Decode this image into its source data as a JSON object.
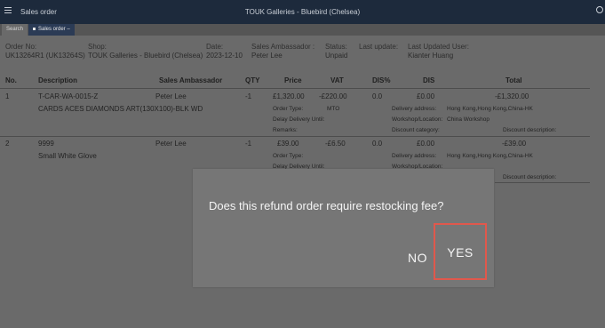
{
  "topbar": {
    "app_title": "Sales order",
    "window_title": "TOUK Galleries - Bluebird (Chelsea)"
  },
  "tabs": {
    "search": "Search",
    "active": "Sales order",
    "active_suffix": "–"
  },
  "header": {
    "order_no_label": "Order No:",
    "order_no_value": "UK13264R1 (UK13264S)",
    "shop_label": "Shop:",
    "shop_value": "TOUK Galleries - Bluebird (Chelsea)",
    "date_label": "Date:",
    "date_value": "2023-12-10",
    "ambassador_label": "Sales Ambassador :",
    "ambassador_value": "Peter Lee",
    "status_label": "Status:",
    "status_value": "Unpaid",
    "last_update_label": "Last update:",
    "last_user_label": "Last Updated User:",
    "last_user_value": "Kianter Huang"
  },
  "table": {
    "columns": [
      "No.",
      "Description",
      "Sales Ambassador",
      "QTY",
      "Price",
      "VAT",
      "DIS%",
      "DIS",
      "Total"
    ],
    "rows": [
      {
        "no": "1",
        "code": "T-CAR-WA-0015-Z",
        "ambassador": "Peter Lee",
        "qty": "-1",
        "price": "£1,320.00",
        "vat": "-£220.00",
        "dis_pct": "0.0",
        "dis": "£0.00",
        "total": "-£1,320.00",
        "desc": "CARDS ACES DIAMONDS ART(130X100)-BLK WD",
        "order_type_label": "Order Type:",
        "order_type_value": "MTO",
        "delivery_address_label": "Delivery address:",
        "delivery_address_value": "Hong Kong,Hong Kong,China-HK",
        "delay_label": "Delay Delivery Until:",
        "workshop_label": "Workshop/Location:",
        "workshop_value": "China Workshop",
        "remarks_label": "Remarks:",
        "discount_cat_label": "Discount category:",
        "discount_desc_label": "Discount description:"
      },
      {
        "no": "2",
        "code": "9999",
        "ambassador": "Peter Lee",
        "qty": "-1",
        "price": "£39.00",
        "vat": "-£6.50",
        "dis_pct": "0.0",
        "dis": "£0.00",
        "total": "-£39.00",
        "desc": "Small White Glove",
        "order_type_label": "Order Type:",
        "delivery_address_label": "Delivery address:",
        "delivery_address_value": "Hong Kong,Hong Kong,China-HK",
        "delay_label": "Delay Delivery Until:",
        "workshop_label": "Workshop/Location:",
        "discount_desc_label": "Discount description:"
      }
    ]
  },
  "dialog": {
    "message": "Does this refund order require restocking fee?",
    "no_label": "NO",
    "yes_label": "YES",
    "highlight_color": "#e0584c"
  }
}
